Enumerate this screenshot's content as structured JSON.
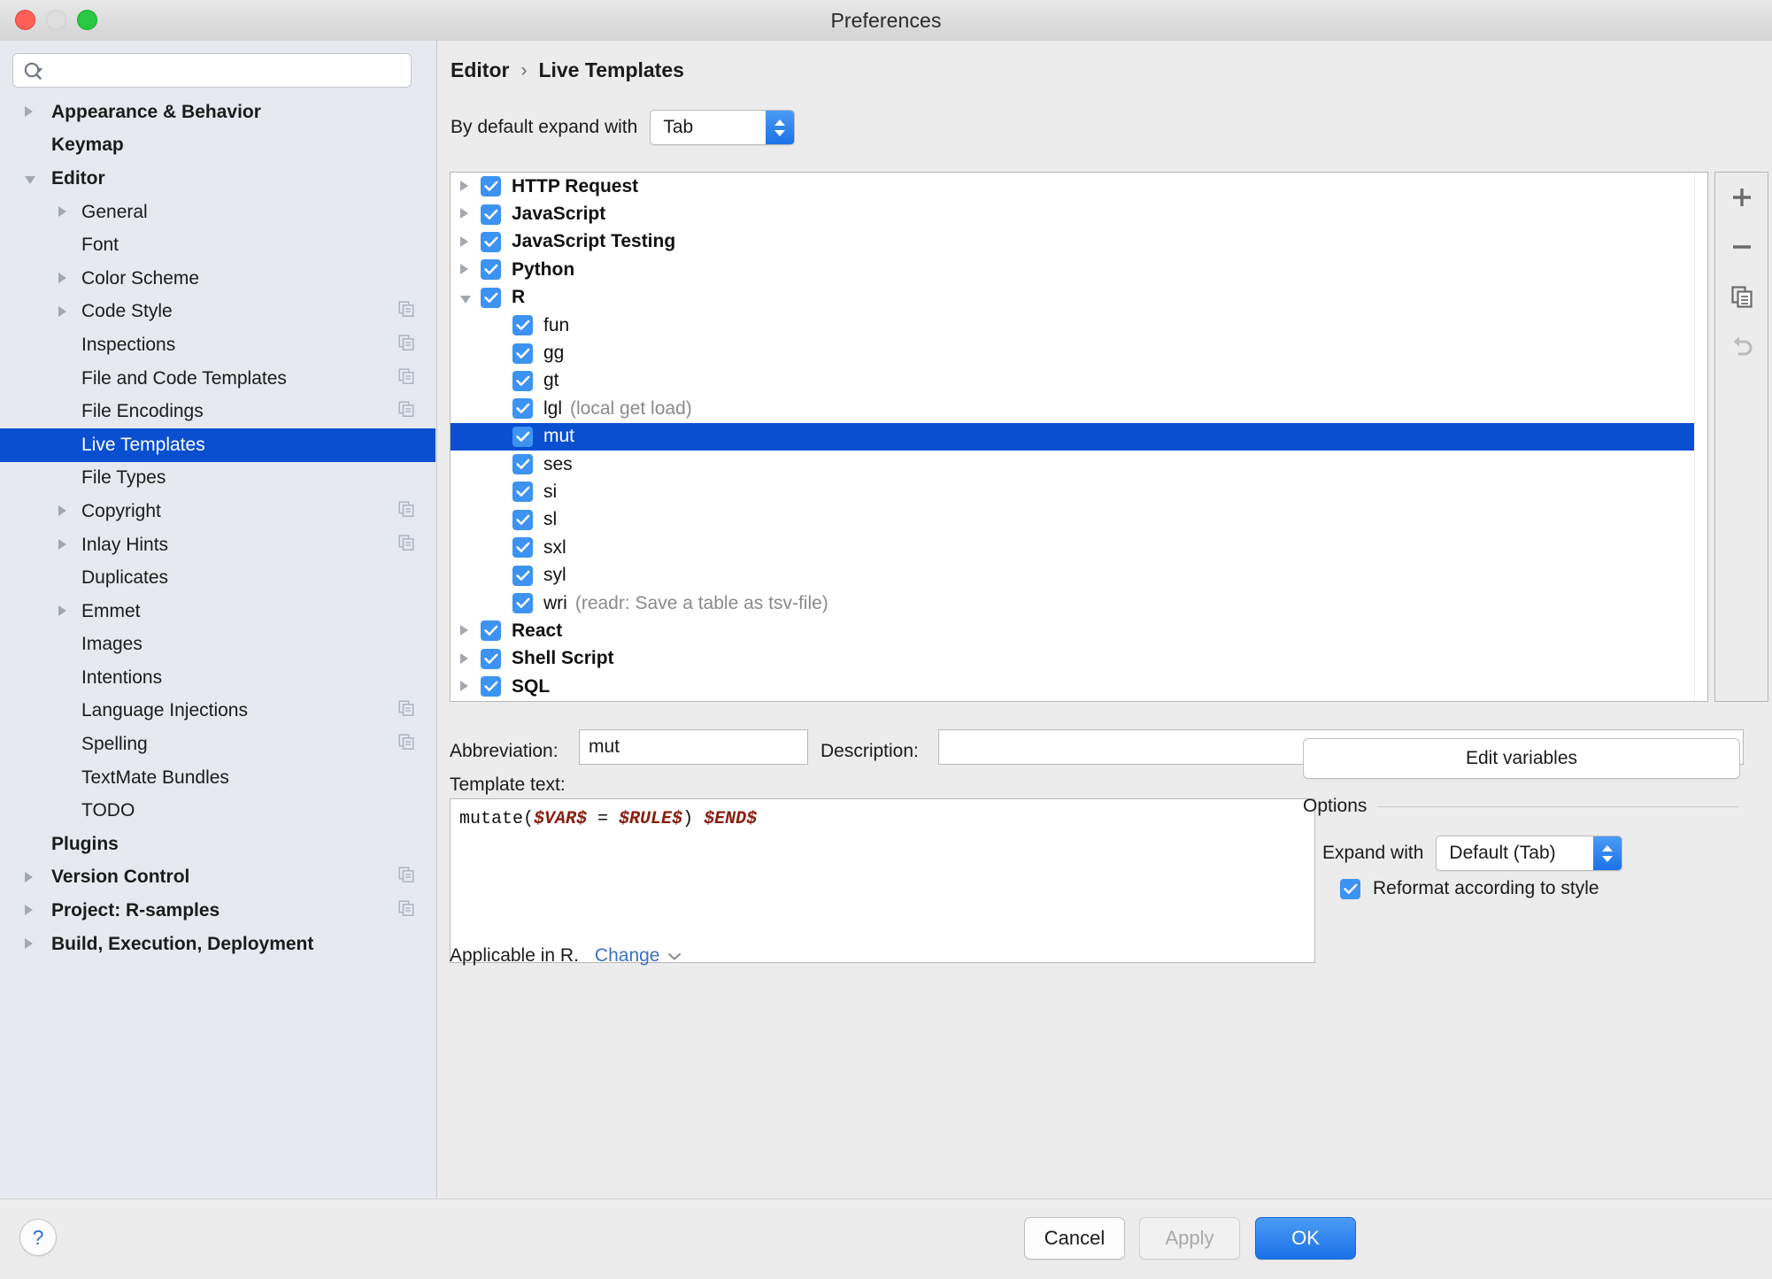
{
  "window": {
    "title": "Preferences",
    "traffic_lights": [
      "close",
      "minimize",
      "zoom"
    ]
  },
  "sidebar": {
    "search": {
      "value": "",
      "placeholder": ""
    },
    "items": [
      {
        "label": "Appearance & Behavior",
        "indent": 0,
        "arrow": "right",
        "bold": true,
        "copy": false,
        "selected": false
      },
      {
        "label": "Keymap",
        "indent": 0,
        "arrow": "none",
        "bold": true,
        "copy": false,
        "selected": false
      },
      {
        "label": "Editor",
        "indent": 0,
        "arrow": "down",
        "bold": true,
        "copy": false,
        "selected": false
      },
      {
        "label": "General",
        "indent": 1,
        "arrow": "right",
        "bold": false,
        "copy": false,
        "selected": false
      },
      {
        "label": "Font",
        "indent": 1,
        "arrow": "none",
        "bold": false,
        "copy": false,
        "selected": false
      },
      {
        "label": "Color Scheme",
        "indent": 1,
        "arrow": "right",
        "bold": false,
        "copy": false,
        "selected": false
      },
      {
        "label": "Code Style",
        "indent": 1,
        "arrow": "right",
        "bold": false,
        "copy": true,
        "selected": false
      },
      {
        "label": "Inspections",
        "indent": 1,
        "arrow": "none",
        "bold": false,
        "copy": true,
        "selected": false
      },
      {
        "label": "File and Code Templates",
        "indent": 1,
        "arrow": "none",
        "bold": false,
        "copy": true,
        "selected": false
      },
      {
        "label": "File Encodings",
        "indent": 1,
        "arrow": "none",
        "bold": false,
        "copy": true,
        "selected": false
      },
      {
        "label": "Live Templates",
        "indent": 1,
        "arrow": "none",
        "bold": false,
        "copy": false,
        "selected": true
      },
      {
        "label": "File Types",
        "indent": 1,
        "arrow": "none",
        "bold": false,
        "copy": false,
        "selected": false
      },
      {
        "label": "Copyright",
        "indent": 1,
        "arrow": "right",
        "bold": false,
        "copy": true,
        "selected": false
      },
      {
        "label": "Inlay Hints",
        "indent": 1,
        "arrow": "right",
        "bold": false,
        "copy": true,
        "selected": false
      },
      {
        "label": "Duplicates",
        "indent": 1,
        "arrow": "none",
        "bold": false,
        "copy": false,
        "selected": false
      },
      {
        "label": "Emmet",
        "indent": 1,
        "arrow": "right",
        "bold": false,
        "copy": false,
        "selected": false
      },
      {
        "label": "Images",
        "indent": 1,
        "arrow": "none",
        "bold": false,
        "copy": false,
        "selected": false
      },
      {
        "label": "Intentions",
        "indent": 1,
        "arrow": "none",
        "bold": false,
        "copy": false,
        "selected": false
      },
      {
        "label": "Language Injections",
        "indent": 1,
        "arrow": "none",
        "bold": false,
        "copy": true,
        "selected": false
      },
      {
        "label": "Spelling",
        "indent": 1,
        "arrow": "none",
        "bold": false,
        "copy": true,
        "selected": false
      },
      {
        "label": "TextMate Bundles",
        "indent": 1,
        "arrow": "none",
        "bold": false,
        "copy": false,
        "selected": false
      },
      {
        "label": "TODO",
        "indent": 1,
        "arrow": "none",
        "bold": false,
        "copy": false,
        "selected": false
      },
      {
        "label": "Plugins",
        "indent": 0,
        "arrow": "none",
        "bold": true,
        "copy": false,
        "selected": false
      },
      {
        "label": "Version Control",
        "indent": 0,
        "arrow": "right",
        "bold": true,
        "copy": true,
        "selected": false
      },
      {
        "label": "Project: R-samples",
        "indent": 0,
        "arrow": "right",
        "bold": true,
        "copy": true,
        "selected": false
      },
      {
        "label": "Build, Execution, Deployment",
        "indent": 0,
        "arrow": "right",
        "bold": true,
        "copy": false,
        "selected": false
      }
    ]
  },
  "main": {
    "breadcrumb": {
      "parent": "Editor",
      "separator": "›",
      "current": "Live Templates"
    },
    "default_expand": {
      "label": "By default expand with",
      "value": "Tab"
    },
    "tree": [
      {
        "name": "HTTP Request",
        "desc": "",
        "level": 0,
        "arrow": "right",
        "checked": true,
        "selected": false
      },
      {
        "name": "JavaScript",
        "desc": "",
        "level": 0,
        "arrow": "right",
        "checked": true,
        "selected": false
      },
      {
        "name": "JavaScript Testing",
        "desc": "",
        "level": 0,
        "arrow": "right",
        "checked": true,
        "selected": false
      },
      {
        "name": "Python",
        "desc": "",
        "level": 0,
        "arrow": "right",
        "checked": true,
        "selected": false
      },
      {
        "name": "R",
        "desc": "",
        "level": 0,
        "arrow": "down",
        "checked": true,
        "selected": false
      },
      {
        "name": "fun",
        "desc": "",
        "level": 1,
        "arrow": "none",
        "checked": true,
        "selected": false
      },
      {
        "name": "gg",
        "desc": "",
        "level": 1,
        "arrow": "none",
        "checked": true,
        "selected": false
      },
      {
        "name": "gt",
        "desc": "",
        "level": 1,
        "arrow": "none",
        "checked": true,
        "selected": false
      },
      {
        "name": "lgl",
        "desc": "(local get load)",
        "level": 1,
        "arrow": "none",
        "checked": true,
        "selected": false
      },
      {
        "name": "mut",
        "desc": "",
        "level": 1,
        "arrow": "none",
        "checked": true,
        "selected": true
      },
      {
        "name": "ses",
        "desc": "",
        "level": 1,
        "arrow": "none",
        "checked": true,
        "selected": false
      },
      {
        "name": "si",
        "desc": "",
        "level": 1,
        "arrow": "none",
        "checked": true,
        "selected": false
      },
      {
        "name": "sl",
        "desc": "",
        "level": 1,
        "arrow": "none",
        "checked": true,
        "selected": false
      },
      {
        "name": "sxl",
        "desc": "",
        "level": 1,
        "arrow": "none",
        "checked": true,
        "selected": false
      },
      {
        "name": "syl",
        "desc": "",
        "level": 1,
        "arrow": "none",
        "checked": true,
        "selected": false
      },
      {
        "name": "wri",
        "desc": "(readr: Save a table as tsv-file)",
        "level": 1,
        "arrow": "none",
        "checked": true,
        "selected": false
      },
      {
        "name": "React",
        "desc": "",
        "level": 0,
        "arrow": "right",
        "checked": true,
        "selected": false
      },
      {
        "name": "Shell Script",
        "desc": "",
        "level": 0,
        "arrow": "right",
        "checked": true,
        "selected": false
      },
      {
        "name": "SQL",
        "desc": "",
        "level": 0,
        "arrow": "right",
        "checked": true,
        "selected": false
      }
    ],
    "toolbar": [
      {
        "icon": "plus-icon",
        "name": "add",
        "enabled": true
      },
      {
        "icon": "minus-icon",
        "name": "remove",
        "enabled": true
      },
      {
        "icon": "duplicate-icon",
        "name": "copy",
        "enabled": true
      },
      {
        "icon": "undo-icon",
        "name": "revert",
        "enabled": false
      }
    ],
    "abbreviation": {
      "label": "Abbreviation:",
      "value": "mut"
    },
    "description": {
      "label": "Description:",
      "value": ""
    },
    "template_text": {
      "label": "Template text:",
      "parts": [
        {
          "t": "mutate(",
          "var": false
        },
        {
          "t": "$VAR$",
          "var": true
        },
        {
          "t": " = ",
          "var": false
        },
        {
          "t": "$RULE$",
          "var": true
        },
        {
          "t": ") ",
          "var": false
        },
        {
          "t": "$END$",
          "var": true
        }
      ],
      "plain": "mutate($VAR$ = $RULE$) $END$"
    },
    "applicable": {
      "text": "Applicable in R.",
      "change_label": "Change"
    },
    "edit_variables_label": "Edit variables",
    "options": {
      "legend": "Options",
      "expand_with": {
        "label": "Expand with",
        "value": "Default (Tab)"
      },
      "reformat": {
        "label": "Reformat according to style",
        "checked": true
      }
    }
  },
  "footer": {
    "help_label": "?",
    "cancel_label": "Cancel",
    "apply_label": "Apply",
    "ok_label": "OK"
  },
  "colors": {
    "selection_blue": "#0a4fd0",
    "checkbox_blue": "#3c93f2",
    "accent_button": "#1b72e8",
    "link_blue": "#3b72c4",
    "template_var_red": "#8a1f11"
  }
}
